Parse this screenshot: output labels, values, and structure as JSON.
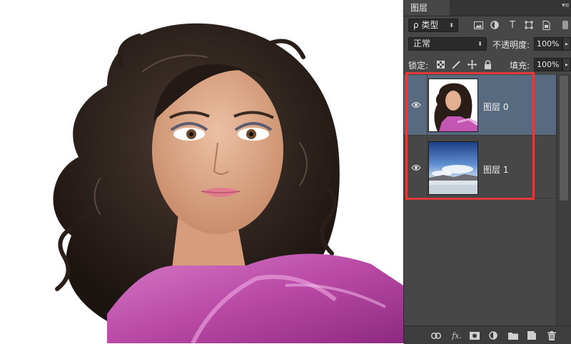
{
  "panel": {
    "tab_label": "图层",
    "menu_glyph": "▾≡"
  },
  "filter": {
    "label": "ρ 类型",
    "arrow": "⬍"
  },
  "blend": {
    "mode": "正常",
    "arrow": "⬍",
    "opacity_label": "不透明度:",
    "opacity_value": "100%"
  },
  "lock": {
    "label": "锁定:",
    "fill_label": "填充:",
    "fill_value": "100%"
  },
  "layers": [
    {
      "name": "图层 0",
      "selected": true
    },
    {
      "name": "图层 1",
      "selected": false
    }
  ],
  "colors": {
    "selected_row": "#586a80",
    "highlight": "#e23a3a",
    "panel_bg": "#474747"
  },
  "icons": {
    "bottom": [
      "link-icon",
      "fx-icon",
      "mask-icon",
      "adjustment-icon",
      "folder-icon",
      "new-layer-icon",
      "trash-icon"
    ],
    "fx_text": "fx."
  }
}
